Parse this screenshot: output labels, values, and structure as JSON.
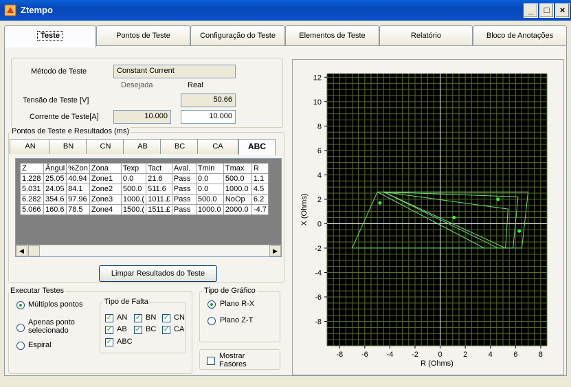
{
  "window": {
    "title": "Ztempo",
    "btn_min": "_",
    "btn_max": "□",
    "btn_close": "×"
  },
  "tabs": [
    "Teste",
    "Pontos de Teste",
    "Configuração do Teste",
    "Elementos de Teste",
    "Relatório",
    "Bloco de Anotações"
  ],
  "form": {
    "metodo_label": "Método de Teste",
    "metodo_value": "Constant Current",
    "desejada": "Desejada",
    "real": "Real",
    "tensao_label": "Tensão de Teste [V]",
    "tensao_real": "50.66",
    "corrente_label": "Corrente de Teste[A]",
    "corrente_desejada": "10.000",
    "corrente_real": "10.000"
  },
  "pontos": {
    "group_label": "Pontos de Teste e Resultados (ms)",
    "subtabs": [
      "AN",
      "BN",
      "CN",
      "AB",
      "BC",
      "CA",
      "ABC"
    ],
    "columns": [
      "Z",
      "Ângul",
      "%Zon",
      "Zona",
      "Texp",
      "Tact",
      "Aval.",
      "Tmin",
      "Tmax",
      "R"
    ],
    "rows": [
      [
        "1.228",
        "25.05",
        "40.94",
        "Zone1",
        "0.0",
        "21.6",
        "Pass",
        "0.0",
        "500.0",
        "1.1"
      ],
      [
        "5.031",
        "24.05",
        "84.1",
        "Zone2",
        "500.0",
        "511.6",
        "Pass",
        "0.0",
        "1000.0",
        "4.5"
      ],
      [
        "6.282",
        "354.6",
        "97.96",
        "Zone3",
        "1000.(",
        "1011.£",
        "Pass",
        "500.0",
        "NoOp",
        "6.2"
      ],
      [
        "5.066",
        "160.6",
        "78.5",
        "Zone4",
        "1500.(",
        "1511.£",
        "Pass",
        "1000.0",
        "2000.0",
        "-4.7"
      ]
    ],
    "clear_button": "Limpar Resultados do Teste"
  },
  "executar": {
    "label": "Executar Testes",
    "multiplos": "Múltiplos pontos",
    "apenas": "Apenas ponto selecionado",
    "espiral": "Espiral"
  },
  "tipo_falta": {
    "label": "Tipo de Falta",
    "an": "AN",
    "bn": "BN",
    "cn": "CN",
    "ab": "AB",
    "bc": "BC",
    "ca": "CA",
    "abc": "ABC"
  },
  "tipo_grafico": {
    "label": "Tipo de Gráfico",
    "plano_rx": "Plano R-X",
    "plano_zt": "Plano Z-T"
  },
  "mostrar_fasores": "Mostrar Fasores",
  "chart_data": {
    "type": "scatter",
    "xlabel": "R (Ohms)",
    "ylabel": "X (Ohms)",
    "xlim": [
      -9,
      8.5
    ],
    "ylim": [
      -10,
      12.3
    ],
    "xticks": [
      -8,
      -6,
      -4,
      -2,
      0,
      2,
      4,
      6,
      8
    ],
    "yticks": [
      -8,
      -6,
      -4,
      -2,
      0,
      2,
      4,
      6,
      8,
      10,
      12
    ],
    "grid": true,
    "background": "#000000",
    "grid_color": "#5a6e2a",
    "zone_color": "#6fdc6f",
    "points": [
      {
        "x": -4.8,
        "y": 1.7
      },
      {
        "x": 1.1,
        "y": 0.5
      },
      {
        "x": 4.6,
        "y": 2.0
      },
      {
        "x": 6.3,
        "y": -0.6
      }
    ],
    "zones": [
      [
        [
          -7.0,
          -2.0
        ],
        [
          -5.0,
          2.6
        ],
        [
          7.0,
          2.6
        ],
        [
          6.5,
          -2.0
        ]
      ],
      [
        [
          -4.5,
          2.6
        ],
        [
          6.2,
          2.2
        ],
        [
          5.8,
          -2.0
        ],
        [
          4.6,
          -2.0
        ]
      ],
      [
        [
          -5.0,
          2.6
        ],
        [
          3.5,
          -2.0
        ]
      ],
      [
        [
          -4.5,
          2.6
        ],
        [
          5.4,
          1.2
        ],
        [
          5.2,
          -2.0
        ]
      ]
    ]
  }
}
